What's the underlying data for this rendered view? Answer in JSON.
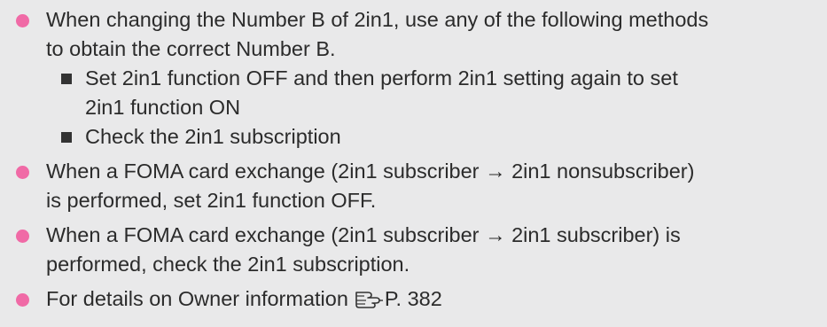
{
  "colors": {
    "background": "#e9e9ea",
    "bullet": "#f06aa6",
    "text": "#2b2b2b",
    "square": "#333333"
  },
  "notes": [
    {
      "line1": "When changing the Number B of 2in1, use any of the following methods",
      "line2": "to obtain the correct Number B.",
      "subitems": [
        {
          "line1": "Set 2in1 function OFF and then perform 2in1 setting again to set",
          "line2": "2in1 function ON"
        },
        {
          "line1": "Check the 2in1 subscription"
        }
      ]
    },
    {
      "line1": "When a FOMA card exchange (2in1 subscriber → 2in1 nonsubscriber)",
      "line2": "is performed, set 2in1 function OFF."
    },
    {
      "line1": "When a FOMA card exchange (2in1 subscriber → 2in1 subscriber) is",
      "line2": "performed, check the 2in1 subscription."
    },
    {
      "text": "For details on Owner information",
      "ref_icon": "pointing-hand-icon",
      "page_ref": "P. 382"
    }
  ]
}
